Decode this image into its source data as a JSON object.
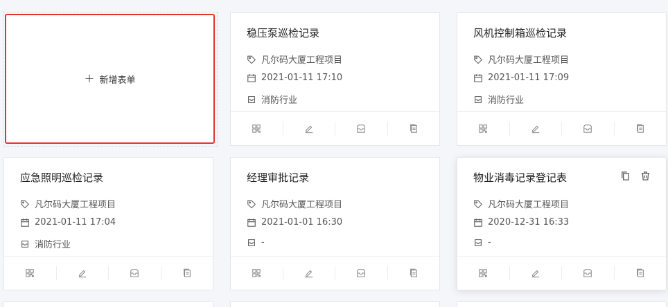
{
  "add_card": {
    "label": "新增表单"
  },
  "cards": [
    {
      "title": "稳压泵巡检记录",
      "project": "凡尔码大厦工程项目",
      "date": "2021-01-11 17:10",
      "category": "消防行业"
    },
    {
      "title": "风机控制箱巡检记录",
      "project": "凡尔码大厦工程项目",
      "date": "2021-01-11 17:09",
      "category": "消防行业"
    },
    {
      "title": "应急照明巡检记录",
      "project": "凡尔码大厦工程项目",
      "date": "2021-01-11 17:04",
      "category": "消防行业"
    },
    {
      "title": "经理审批记录",
      "project": "凡尔码大厦工程项目",
      "date": "2021-01-01 16:30",
      "category": "-"
    },
    {
      "title": "物业消毒记录登记表",
      "project": "凡尔码大厦工程项目",
      "date": "2020-12-31 16:33",
      "category": "-"
    }
  ],
  "icons": {
    "tag": "tag-icon",
    "calendar": "calendar-icon",
    "category": "box-icon",
    "actions": [
      "qrcode-icon",
      "edit-icon",
      "inbox-icon",
      "document-icon"
    ],
    "top_tools": [
      "copy-icon",
      "delete-icon"
    ]
  },
  "colors": {
    "accent_border": "#e5332a",
    "background": "#f5f6f9",
    "icon": "#888888"
  }
}
